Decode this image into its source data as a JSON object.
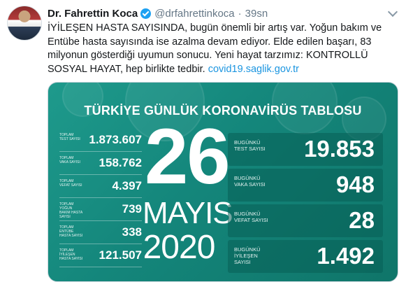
{
  "tweet": {
    "author_name": "Dr. Fahrettin Koca",
    "handle": "@drfahrettinkoca",
    "separator": "·",
    "time": "39sn",
    "text_line1": "İYİLEŞEN HASTA SAYISINDA, bugün önemli bir artış var. Yoğun bakım ve",
    "text_line2": "Entübe hasta sayısında ise azalma devam ediyor. Elde edilen başarı, 83",
    "text_line3": "milyonun gösterdiği uyumun sonucu. Yeni hayat tarzımız: KONTROLLÜ",
    "text_line4_prefix": "SOSYAL HAYAT, hep birlikte tedbir. ",
    "link": "covid19.saglik.gov.tr"
  },
  "card": {
    "title": "TÜRKİYE GÜNLÜK KORONAVİRÜS TABLOSU",
    "day": "26",
    "month": "MAYIS",
    "year": "2020",
    "totals": [
      {
        "label": "TOPLAM TEST SAYISI",
        "value": "1.873.607"
      },
      {
        "label": "TOPLAM VAKA SAYISI",
        "value": "158.762"
      },
      {
        "label": "TOPLAM VEFAT SAYISI",
        "value": "4.397"
      },
      {
        "label": "TOPLAM YOĞUN BAKIM HASTA SAYISI",
        "value": "739"
      },
      {
        "label": "TOPLAM ENTÜBE HASTA SAYISI",
        "value": "338"
      },
      {
        "label": "TOPLAM İYİLEŞEN HASTA SAYISI",
        "value": "121.507"
      }
    ],
    "today": [
      {
        "label": "BUGÜNKÜ TEST SAYISI",
        "value": "19.853"
      },
      {
        "label": "BUGÜNKÜ VAKA SAYISI",
        "value": "948"
      },
      {
        "label": "BUGÜNKÜ VEFAT SAYISI",
        "value": "28"
      },
      {
        "label": "BUGÜNKÜ İYİLEŞEN SAYISI",
        "value": "1.492"
      }
    ]
  },
  "icons": [
    "verified-badge-icon",
    "chevron-down-icon"
  ],
  "colors": {
    "link": "#1b95e0",
    "verified": "#1da1f2",
    "card_teal": "#1e9a8c"
  }
}
